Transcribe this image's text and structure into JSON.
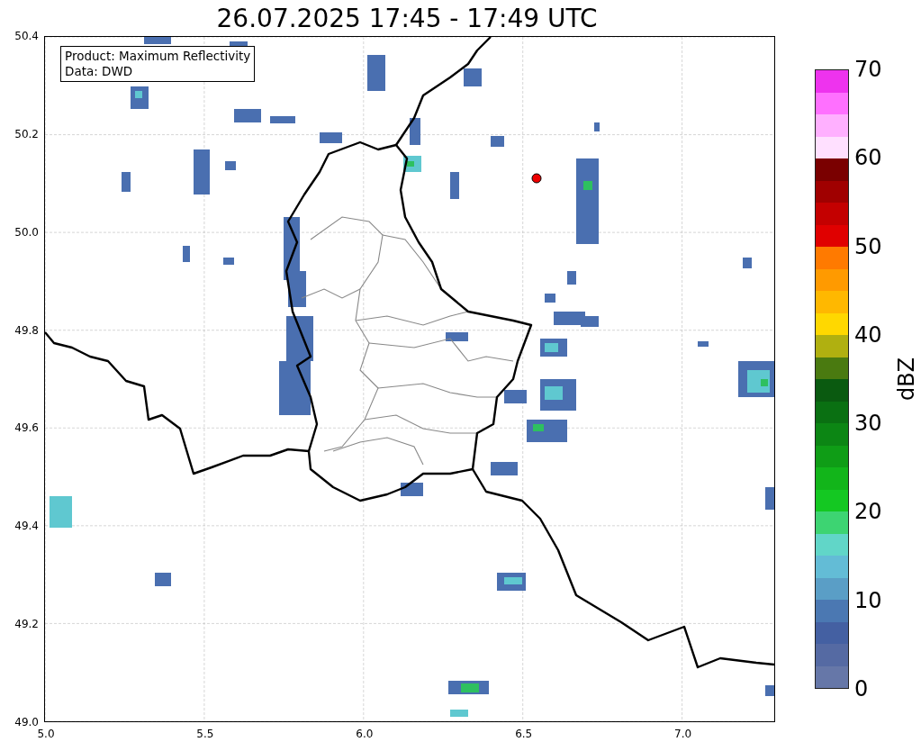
{
  "title": "26.07.2025 17:45 - 17:49 UTC",
  "legend": {
    "lines": [
      "Product: Maximum Reflectivity",
      "Data: DWD"
    ]
  },
  "y_axis": {
    "ticks": [
      "50.4",
      "50.2",
      "50.0",
      "49.8",
      "49.6",
      "49.4",
      "49.2",
      "49.0"
    ]
  },
  "x_axis": {
    "ticks": [
      "5.0",
      "5.5",
      "6.0",
      "6.5",
      "7.0"
    ]
  },
  "colorbar": {
    "label": "dBZ",
    "ticks": [
      "70",
      "60",
      "50",
      "40",
      "30",
      "20",
      "10",
      "0"
    ],
    "bands": [
      {
        "color": "#ee33ee"
      },
      {
        "color": "#ff70ff"
      },
      {
        "color": "#ffb0ff"
      },
      {
        "color": "#ffe0ff"
      },
      {
        "color": "#7a0000"
      },
      {
        "color": "#a00000"
      },
      {
        "color": "#c40000"
      },
      {
        "color": "#e00000"
      },
      {
        "color": "#ff7a00"
      },
      {
        "color": "#ff9a00"
      },
      {
        "color": "#ffb800"
      },
      {
        "color": "#ffd800"
      },
      {
        "color": "#b0b010"
      },
      {
        "color": "#4a7a10"
      },
      {
        "color": "#0a5a10"
      },
      {
        "color": "#0a7012"
      },
      {
        "color": "#0c8614"
      },
      {
        "color": "#0f9d16"
      },
      {
        "color": "#12b51a"
      },
      {
        "color": "#14c822"
      },
      {
        "color": "#3dd472"
      },
      {
        "color": "#61d6c8"
      },
      {
        "color": "#63bcd6"
      },
      {
        "color": "#5a9ec6"
      },
      {
        "color": "#4b78b2"
      },
      {
        "color": "#4460a2"
      },
      {
        "color": "#556aa3"
      },
      {
        "color": "#6677a8"
      }
    ]
  }
}
